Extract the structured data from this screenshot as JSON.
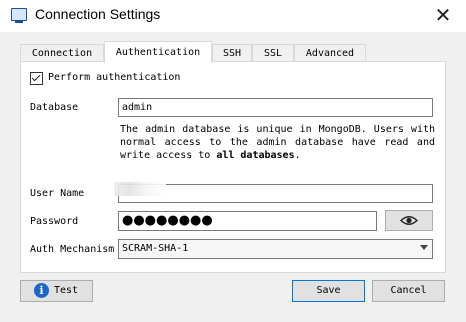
{
  "window": {
    "title": "Connection Settings",
    "close_label": "✕"
  },
  "tabs": [
    {
      "label": "Connection",
      "active": false
    },
    {
      "label": "Authentication",
      "active": true
    },
    {
      "label": "SSH",
      "active": false
    },
    {
      "label": "SSL",
      "active": false
    },
    {
      "label": "Advanced",
      "active": false
    }
  ],
  "auth": {
    "perform_label": "Perform authentication",
    "perform_checked": true,
    "database_label": "Database",
    "database_value": "admin",
    "description_part1": "The admin database is unique in MongoDB. Users with normal access to the admin database have read and write access to ",
    "description_bold": "all databases",
    "description_part2": ".",
    "username_label": "User Name",
    "username_value": "",
    "password_label": "Password",
    "password_mask": "●●●●●●●●",
    "mechanism_label": "Auth Mechanism",
    "mechanism_value": "SCRAM-SHA-1"
  },
  "buttons": {
    "test": "Test",
    "save": "Save",
    "cancel": "Cancel"
  },
  "icons": {
    "app": "window-icon",
    "info": "info-icon",
    "eye": "eye-icon",
    "dropdown": "chevron-down-icon"
  },
  "colors": {
    "accent": "#0078d7",
    "info_blue": "#1c67c7"
  }
}
